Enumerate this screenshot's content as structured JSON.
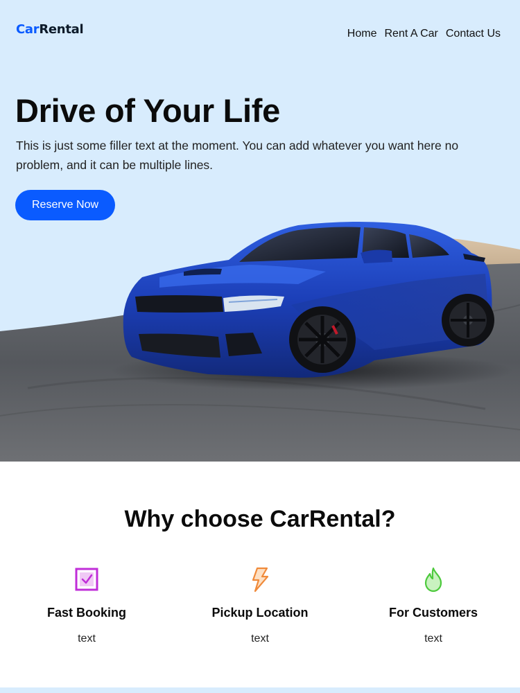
{
  "header": {
    "logo_part1": "Car",
    "logo_part2": "Rental",
    "nav": [
      "Home",
      "Rent A Car",
      "Contact Us"
    ]
  },
  "hero": {
    "title": "Drive of Your Life",
    "text": "This is just some filler text at the moment. You can add whatever you want here no problem, and it can be multiple lines.",
    "cta_label": "Reserve Now"
  },
  "why": {
    "title": "Why choose CarRental?",
    "features": [
      {
        "icon": "checkbox-icon",
        "title": "Fast Booking",
        "text": "text"
      },
      {
        "icon": "lightning-icon",
        "title": "Pickup Location",
        "text": "text"
      },
      {
        "icon": "flame-icon",
        "title": "For Customers",
        "text": "text"
      }
    ]
  },
  "colors": {
    "accent": "#0a5bff",
    "hero_bg": "#d8ecfd",
    "icon_purple": "#c02ed8",
    "icon_orange": "#f08a3a",
    "icon_green": "#4cc93c"
  }
}
